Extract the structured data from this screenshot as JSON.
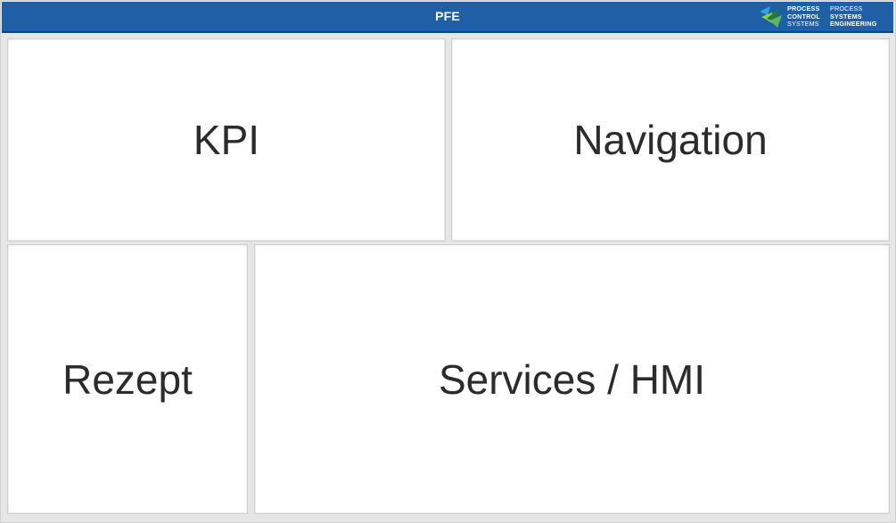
{
  "header": {
    "title": "PFE",
    "background_color": "#1f5fa6",
    "logo": {
      "icon": "process-systems-logo-icon",
      "left_lines": [
        "PROCESS",
        "CONTROL",
        "SYSTEMS"
      ],
      "right_lines": [
        "PROCESS",
        "SYSTEMS",
        "ENGINEERING"
      ],
      "colors": [
        "#9ccc3c",
        "#2aa9e0",
        "#1f7a3c"
      ]
    }
  },
  "panels": {
    "kpi": {
      "label": "KPI"
    },
    "navigation": {
      "label": "Navigation"
    },
    "rezept": {
      "label": "Rezept"
    },
    "services": {
      "label": "Services / HMI"
    }
  }
}
